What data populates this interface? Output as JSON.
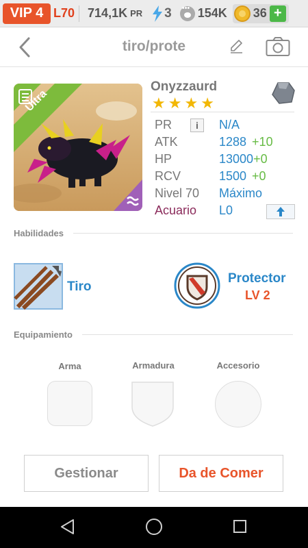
{
  "status_bar": {
    "vip": "VIP 4",
    "level": "L70",
    "gold": "714,1K",
    "gold_unit": "PR",
    "energy": "3",
    "food": "154K",
    "gems": "36",
    "plus": "+",
    "colors": {
      "vip_bg": "#e8542a",
      "plus_bg": "#4cb848"
    }
  },
  "header": {
    "title": "tiro/prote",
    "back_icon": "chevron-left-icon",
    "edit_icon": "pencil-icon",
    "camera_icon": "camera-icon"
  },
  "creature": {
    "rarity": "Ultra",
    "name": "Onyzzaurd",
    "stars": [
      "★",
      "★",
      "★",
      "★"
    ],
    "element_icon": "water-element-icon",
    "stats": {
      "pr_label": "PR",
      "pr_value": "N/A",
      "atk_label": "ATK",
      "atk_value": "1288",
      "atk_bonus": "+10",
      "hp_label": "HP",
      "hp_value": "13000",
      "hp_bonus": "+0",
      "rcv_label": "RCV",
      "rcv_value": "1500",
      "rcv_bonus": "+0",
      "level_label": "Nivel 70",
      "level_value": "Máximo",
      "element_label": "Acuario",
      "element_value": "L0"
    },
    "info_glyph": "i"
  },
  "abilities": {
    "section_title": "Habilidades",
    "items": [
      {
        "name": "Tiro",
        "icon": "arrows-icon"
      },
      {
        "name": "Protector",
        "level": "LV 2",
        "icon": "shield-icon"
      }
    ]
  },
  "equipment": {
    "section_title": "Equipamiento",
    "slots": [
      {
        "label": "Arma"
      },
      {
        "label": "Armadura"
      },
      {
        "label": "Accesorio"
      }
    ]
  },
  "actions": {
    "manage": "Gestionar",
    "feed": "Da de Comer",
    "colors": {
      "feed_text": "#e8542a",
      "link_blue": "#2a87c8"
    }
  }
}
